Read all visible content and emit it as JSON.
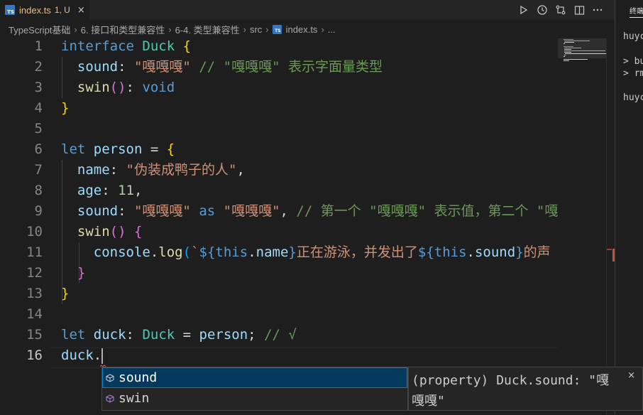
{
  "tab": {
    "name": "index.ts",
    "status": "1, U",
    "close": "×",
    "type_badge": "TS"
  },
  "breadcrumb": [
    "TypeScript基础",
    "6. 接口和类型兼容性",
    "6-4. 类型兼容性",
    "src",
    "index.ts",
    "..."
  ],
  "breadcrumb_sep": "›",
  "colors": {
    "keyword": "#569cd6",
    "type": "#4ec9b0",
    "string": "#ce9178",
    "comment": "#6a9955",
    "property": "#9cdcfe",
    "number": "#b5cea8",
    "function": "#dcdcaa",
    "selection": "#04395e",
    "accent": "#007fd4"
  },
  "line_numbers": [
    "1",
    "2",
    "3",
    "4",
    "5",
    "6",
    "7",
    "8",
    "9",
    "10",
    "11",
    "12",
    "13",
    "14",
    "15",
    "16"
  ],
  "code": {
    "l1": {
      "kw": "interface",
      "name": "Duck",
      "open": "{"
    },
    "l2": {
      "prop": "sound",
      "colon": ": ",
      "str": "\"嘎嘎嘎\"",
      "comment": " // \"嘎嘎嘎\" 表示字面量类型"
    },
    "l3": {
      "prop": "swin",
      "paren": "()",
      "colon": ": ",
      "ret": "void"
    },
    "l4": {
      "close": "}"
    },
    "l6": {
      "kw": "let",
      "name": "person",
      "eq": " = ",
      "open": "{"
    },
    "l7": {
      "prop": "name",
      "colon": ": ",
      "str": "\"伪装成鸭子的人\"",
      "comma": ","
    },
    "l8": {
      "prop": "age",
      "colon": ": ",
      "num": "11",
      "comma": ","
    },
    "l9": {
      "prop": "sound",
      "colon": ": ",
      "str": "\"嘎嘎嘎\"",
      "as": " as ",
      "str2": "\"嘎嘎嘎\"",
      "comma": ",",
      "comment": " // 第一个 \"嘎嘎嘎\" 表示值，第二个 \"嘎"
    },
    "l10": {
      "prop": "swin",
      "paren": "()",
      "open": "{"
    },
    "l11": {
      "obj": "console",
      "dot": ".",
      "fn": "log",
      "lp": "(",
      "tpl_start": "`",
      "d1": "${",
      "this1": "this",
      "dot1": ".",
      "p1": "name",
      "e1": "}",
      "text1": "正在游泳，并发出了",
      "d2": "${",
      "this2": "this",
      "dot2": ".",
      "p2": "sound",
      "e2": "}",
      "text2": "的声"
    },
    "l12": {
      "close": "}"
    },
    "l13": {
      "close": "}"
    },
    "l15": {
      "kw": "let",
      "name": "duck",
      "colon": ": ",
      "type": "Duck",
      "eq": " = ",
      "val": "person",
      "semi": ";",
      "comment": " // √"
    },
    "l16": {
      "name": "duck",
      "dot": "."
    }
  },
  "suggest": [
    {
      "label": "sound",
      "kind": "property"
    },
    {
      "label": "swin",
      "kind": "method"
    }
  ],
  "details": {
    "text": "(property) Duck.sound: \"嘎嘎嘎\"",
    "close": "×"
  },
  "terminal": {
    "title": "终端",
    "lines": [
      "huyc",
      "> bu",
      "> rm",
      "huyc"
    ]
  }
}
